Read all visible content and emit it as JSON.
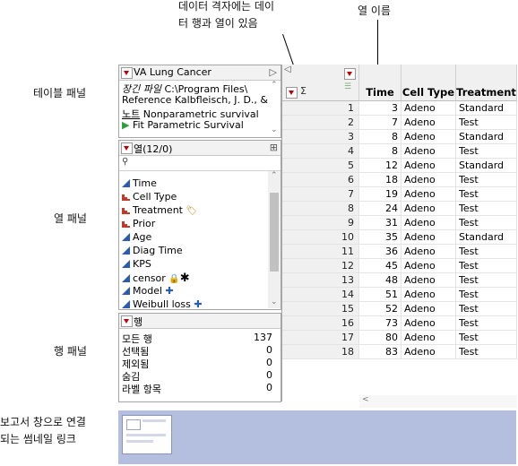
{
  "callouts": {
    "grid_note_line1": "데이터 격자에는 데이",
    "grid_note_line2": "터 행과 열이 있음",
    "col_names": "열 이름",
    "table_panel": "테이블 패널",
    "col_panel": "열 패널",
    "row_panel": "행 패널",
    "thumb_line1": "보고서 창으로 연결",
    "thumb_line2": "되는 썸네일 링크"
  },
  "table_panel": {
    "title": "VA Lung Cancer",
    "items": [
      {
        "label": "장긴 파일",
        "value": "C:\\Program Files\\"
      },
      {
        "label": "Reference",
        "value": "Kalbfleisch, J. D., &"
      },
      {
        "label": "노트",
        "value": "Nonparametric survival"
      },
      {
        "label": "",
        "value": "Fit Parametric Survival"
      }
    ]
  },
  "columns_panel": {
    "title": "열(12/0)",
    "search_icon": "search-icon",
    "columns": [
      {
        "name": "Time",
        "type": "continuous"
      },
      {
        "name": "Cell Type",
        "type": "nominal"
      },
      {
        "name": "Treatment",
        "type": "nominal"
      },
      {
        "name": "Prior",
        "type": "nominal"
      },
      {
        "name": "Age",
        "type": "continuous"
      },
      {
        "name": "Diag Time",
        "type": "continuous"
      },
      {
        "name": "KPS",
        "type": "continuous"
      },
      {
        "name": "censor",
        "type": "continuous"
      },
      {
        "name": "Model",
        "type": "continuous"
      },
      {
        "name": "Weibull loss",
        "type": "continuous"
      }
    ]
  },
  "rows_panel": {
    "title": "행",
    "stats": [
      {
        "label": "모든 행",
        "value": "137"
      },
      {
        "label": "선택됨",
        "value": "0"
      },
      {
        "label": "제외됨",
        "value": "0"
      },
      {
        "label": "숨김",
        "value": "0"
      },
      {
        "label": "라벨 항목",
        "value": "0"
      }
    ]
  },
  "grid": {
    "headers": [
      "Time",
      "Cell Type",
      "Treatment"
    ],
    "rows": [
      {
        "n": "1",
        "time": "3",
        "cell": "Adeno",
        "treat": "Standard"
      },
      {
        "n": "2",
        "time": "7",
        "cell": "Adeno",
        "treat": "Test"
      },
      {
        "n": "3",
        "time": "8",
        "cell": "Adeno",
        "treat": "Standard"
      },
      {
        "n": "4",
        "time": "8",
        "cell": "Adeno",
        "treat": "Test"
      },
      {
        "n": "5",
        "time": "12",
        "cell": "Adeno",
        "treat": "Standard"
      },
      {
        "n": "6",
        "time": "18",
        "cell": "Adeno",
        "treat": "Test"
      },
      {
        "n": "7",
        "time": "19",
        "cell": "Adeno",
        "treat": "Test"
      },
      {
        "n": "8",
        "time": "24",
        "cell": "Adeno",
        "treat": "Test"
      },
      {
        "n": "9",
        "time": "31",
        "cell": "Adeno",
        "treat": "Test"
      },
      {
        "n": "10",
        "time": "35",
        "cell": "Adeno",
        "treat": "Standard"
      },
      {
        "n": "11",
        "time": "36",
        "cell": "Adeno",
        "treat": "Test"
      },
      {
        "n": "12",
        "time": "45",
        "cell": "Adeno",
        "treat": "Test"
      },
      {
        "n": "13",
        "time": "48",
        "cell": "Adeno",
        "treat": "Test"
      },
      {
        "n": "14",
        "time": "51",
        "cell": "Adeno",
        "treat": "Test"
      },
      {
        "n": "15",
        "time": "52",
        "cell": "Adeno",
        "treat": "Test"
      },
      {
        "n": "16",
        "time": "73",
        "cell": "Adeno",
        "treat": "Test"
      },
      {
        "n": "17",
        "time": "80",
        "cell": "Adeno",
        "treat": "Test"
      },
      {
        "n": "18",
        "time": "83",
        "cell": "Adeno",
        "treat": "Test"
      }
    ]
  },
  "colors": {
    "accent_red": "#c00000",
    "continuous_blue": "#2a5db0",
    "nominal_red": "#c0392b",
    "thumb_bg": "#b4bedf"
  }
}
